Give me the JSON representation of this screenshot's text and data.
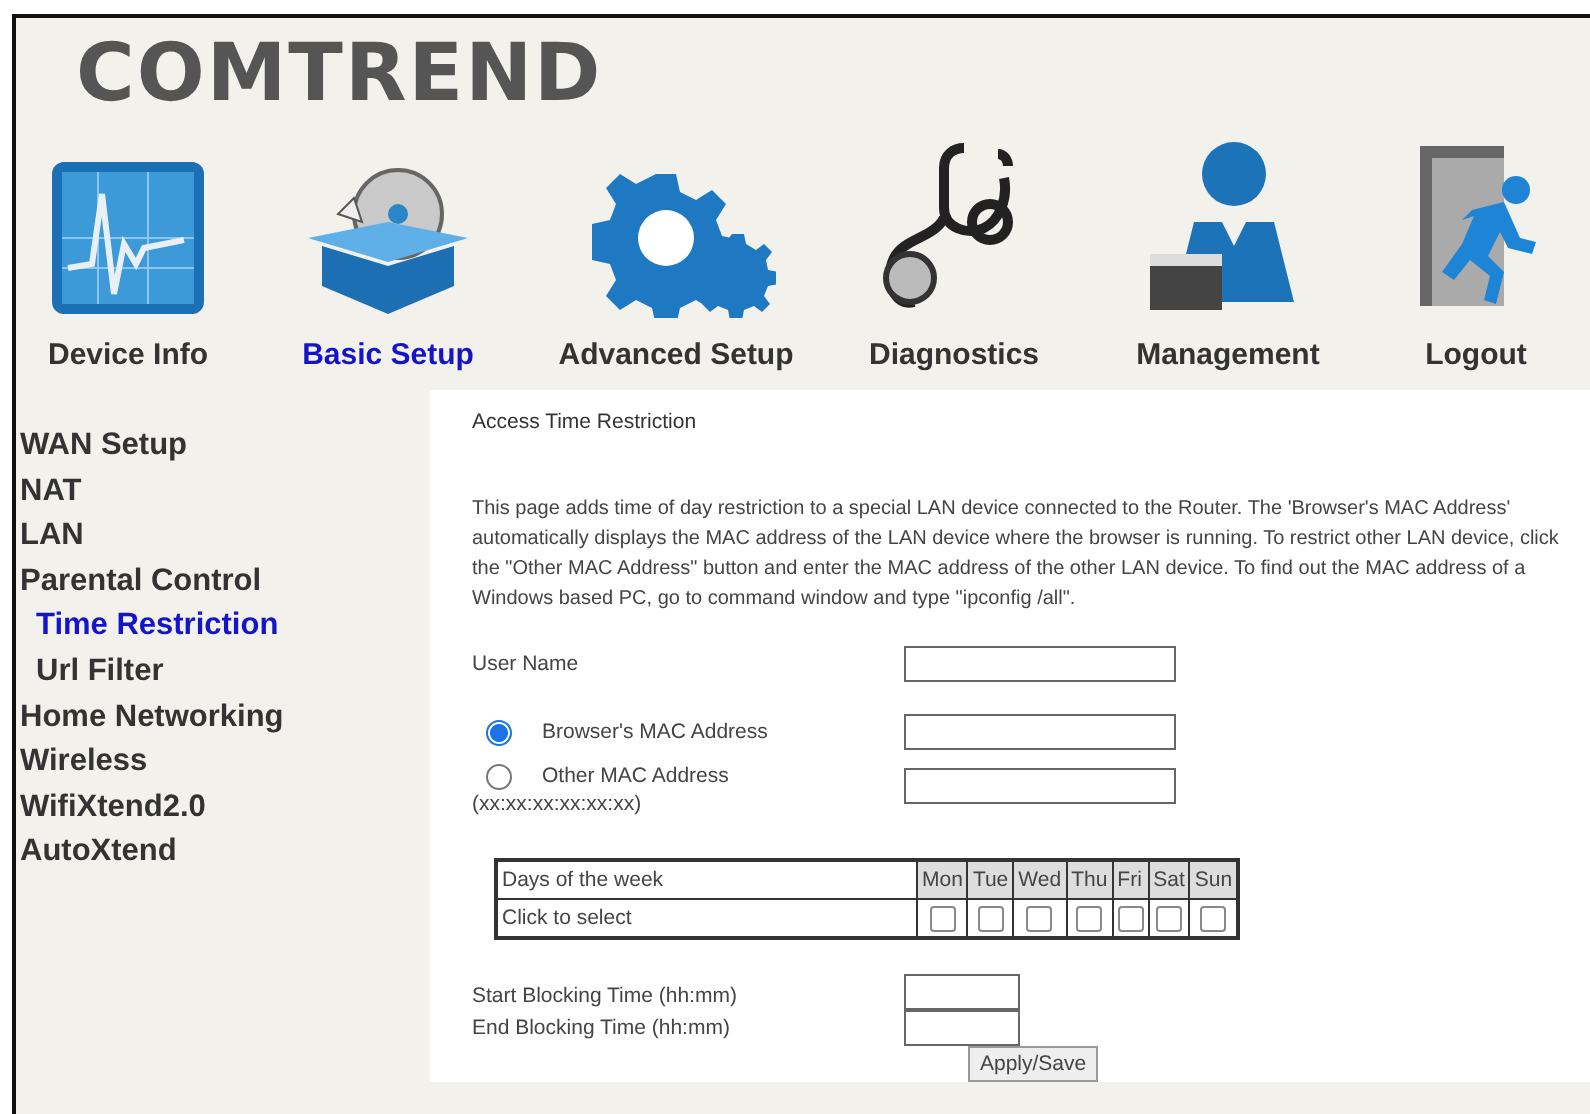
{
  "logo": "COMTREND",
  "nav": [
    {
      "label": "Device Info",
      "selected": false
    },
    {
      "label": "Basic Setup",
      "selected": true
    },
    {
      "label": "Advanced Setup",
      "selected": false
    },
    {
      "label": "Diagnostics",
      "selected": false
    },
    {
      "label": "Management",
      "selected": false
    },
    {
      "label": "Logout",
      "selected": false
    }
  ],
  "sidebar": {
    "items": [
      {
        "label": "WAN Setup",
        "selected": false
      },
      {
        "label": "NAT",
        "selected": false
      },
      {
        "label": "LAN",
        "selected": false
      },
      {
        "label": "Parental Control",
        "selected": false,
        "children": [
          {
            "label": "Time Restriction",
            "selected": true
          },
          {
            "label": "Url Filter",
            "selected": false
          }
        ]
      },
      {
        "label": "Home Networking",
        "selected": false
      },
      {
        "label": "Wireless",
        "selected": false
      },
      {
        "label": "WifiXtend2.0",
        "selected": false
      },
      {
        "label": "AutoXtend",
        "selected": false
      }
    ]
  },
  "content": {
    "title": "Access Time Restriction",
    "description": "This page adds time of day restriction to a special LAN device connected to the Router. The 'Browser's MAC Address' automatically displays the MAC address of the LAN device where the browser is running. To restrict other LAN device, click the \"Other MAC Address\" button and enter the MAC address of the other LAN device. To find out the MAC address of a Windows based PC, go to command window and type \"ipconfig /all\".",
    "user_name_label": "User Name",
    "mac_options": [
      {
        "label": "Browser's MAC Address",
        "selected": true
      },
      {
        "label": "Other MAC Address",
        "selected": false
      }
    ],
    "mac_format": "(xx:xx:xx:xx:xx:xx)",
    "schedule": {
      "header_label": "Days of the week",
      "row_label": "Click to select",
      "days": [
        {
          "label": "Mon",
          "checked": false
        },
        {
          "label": "Tue",
          "checked": false
        },
        {
          "label": "Wed",
          "checked": false
        },
        {
          "label": "Thu",
          "checked": false
        },
        {
          "label": "Fri",
          "checked": false
        },
        {
          "label": "Sat",
          "checked": false
        },
        {
          "label": "Sun",
          "checked": false
        }
      ]
    },
    "start_label": "Start Blocking Time (hh:mm)",
    "end_label": "End Blocking Time (hh:mm)",
    "button": "Apply/Save"
  }
}
